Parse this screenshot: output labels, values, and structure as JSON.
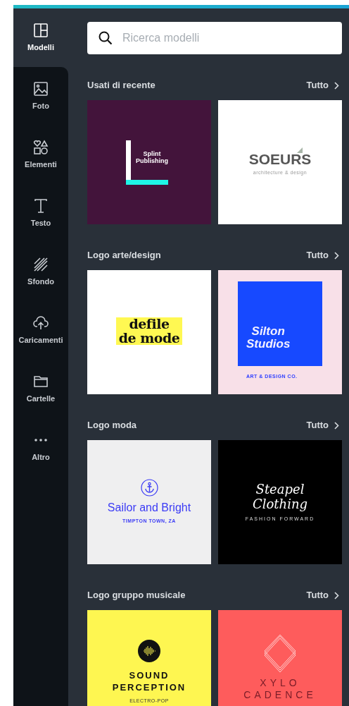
{
  "sidebar": {
    "items": [
      {
        "kind": "templates",
        "label": "Modelli",
        "selected": true
      },
      {
        "kind": "photos",
        "label": "Foto",
        "selected": false
      },
      {
        "kind": "elements",
        "label": "Elementi",
        "selected": false
      },
      {
        "kind": "text",
        "label": "Testo",
        "selected": false
      },
      {
        "kind": "background",
        "label": "Sfondo",
        "selected": false
      },
      {
        "kind": "uploads",
        "label": "Caricamenti",
        "selected": false
      },
      {
        "kind": "folders",
        "label": "Cartelle",
        "selected": false
      },
      {
        "kind": "more",
        "label": "Altro",
        "selected": false
      }
    ]
  },
  "search": {
    "placeholder": "Ricerca modelli"
  },
  "sections": [
    {
      "title": "Usati di recente",
      "link": "Tutto",
      "templates": [
        {
          "kind": "splint",
          "title": [
            "Splint",
            "Publishing"
          ]
        },
        {
          "kind": "soeurs",
          "title": [
            "SOEURS"
          ],
          "tagline": "architecture & design"
        }
      ]
    },
    {
      "title": "Logo arte/design",
      "link": "Tutto",
      "templates": [
        {
          "kind": "defile",
          "title": [
            "defile",
            "de mode"
          ]
        },
        {
          "kind": "silton",
          "title": [
            "Silton",
            "Studios"
          ],
          "tagline": "ART & DESIGN CO."
        }
      ]
    },
    {
      "title": "Logo moda",
      "link": "Tutto",
      "templates": [
        {
          "kind": "sailor",
          "title": [
            "Sailor and Bright"
          ],
          "tagline": "TIMPTON TOWN, ZA"
        },
        {
          "kind": "steapel",
          "title": [
            "Steapel",
            "Clothing"
          ],
          "tagline": "FASHION FORWARD"
        }
      ]
    },
    {
      "title": "Logo gruppo musicale",
      "link": "Tutto",
      "templates": [
        {
          "kind": "sound",
          "title": [
            "SOUND",
            "PERCEPTION"
          ],
          "tagline": "ELECTRO-POP"
        },
        {
          "kind": "xylo",
          "title": [
            "XYLO",
            "CADENCE"
          ]
        }
      ]
    }
  ]
}
